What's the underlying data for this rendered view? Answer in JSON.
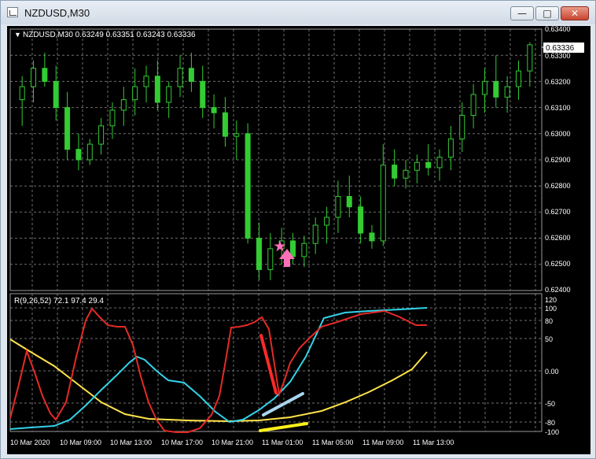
{
  "window": {
    "title": "NZDUSD,M30",
    "controls": {
      "minimize": "—",
      "maximize": "□",
      "close": "✕"
    }
  },
  "colors": {
    "background": "#000000",
    "bull_candle": "#ffffff",
    "bear_candle": "#33cc33",
    "grid": "#6f6f6f",
    "axis_text": "#ffffff",
    "indicator_red": "#e52b26",
    "indicator_cyan": "#33d3e8",
    "indicator_yellow": "#ffe34a",
    "annotation_red": "#ff2a2a",
    "annotation_blue": "#a8d6f0",
    "annotation_yellow": "#ffef1a",
    "marker_pink": "#ff6fb7"
  },
  "main_chart": {
    "header": "NZDUSD,M30  0.63249 0.63351 0.63243 0.63336",
    "current_price_label": "0.63336",
    "price_axis": [
      "0.63400",
      "0.63300",
      "0.63200",
      "0.63100",
      "0.63000",
      "0.62900",
      "0.62800",
      "0.62700",
      "0.62600",
      "0.62500",
      "0.62400"
    ]
  },
  "indicator": {
    "label": "R(9,26,52) 72.1 97.4 29.4",
    "axis_ticks": [
      "120",
      "100",
      "80",
      "50",
      "0.00",
      "-50",
      "-80",
      "-100"
    ]
  },
  "time_axis": [
    "10 Mar 2020",
    "10 Mar 09:00",
    "10 Mar 13:00",
    "10 Mar 17:00",
    "10 Mar 21:00",
    "11 Mar 01:00",
    "11 Mar 05:00",
    "11 Mar 09:00",
    "11 Mar 13:00"
  ],
  "chart_data": {
    "type": "candlestick",
    "symbol": "NZDUSD",
    "timeframe": "M30",
    "ylim": [
      0.624,
      0.634
    ],
    "candles": [
      [
        0.6313,
        0.6322,
        0.6303,
        0.6318
      ],
      [
        0.6318,
        0.6328,
        0.6312,
        0.6325
      ],
      [
        0.6325,
        0.6331,
        0.6318,
        0.632
      ],
      [
        0.632,
        0.6326,
        0.6305,
        0.631
      ],
      [
        0.631,
        0.6316,
        0.629,
        0.6294
      ],
      [
        0.6294,
        0.63,
        0.6286,
        0.629
      ],
      [
        0.629,
        0.6298,
        0.6288,
        0.6296
      ],
      [
        0.6296,
        0.6306,
        0.6292,
        0.6303
      ],
      [
        0.6303,
        0.6312,
        0.6298,
        0.6309
      ],
      [
        0.6309,
        0.6318,
        0.6303,
        0.6313
      ],
      [
        0.6313,
        0.6325,
        0.6307,
        0.6318
      ],
      [
        0.6318,
        0.6326,
        0.6312,
        0.6322
      ],
      [
        0.6322,
        0.6328,
        0.6309,
        0.6312
      ],
      [
        0.6312,
        0.632,
        0.6306,
        0.6318
      ],
      [
        0.6318,
        0.633,
        0.6314,
        0.6325
      ],
      [
        0.6325,
        0.6331,
        0.6316,
        0.632
      ],
      [
        0.632,
        0.6326,
        0.6306,
        0.631
      ],
      [
        0.631,
        0.6315,
        0.6302,
        0.6308
      ],
      [
        0.6308,
        0.6314,
        0.6295,
        0.6299
      ],
      [
        0.6299,
        0.6305,
        0.629,
        0.63
      ],
      [
        0.63,
        0.6304,
        0.6258,
        0.626
      ],
      [
        0.626,
        0.6266,
        0.6244,
        0.6248
      ],
      [
        0.6248,
        0.6262,
        0.6244,
        0.6256
      ],
      [
        0.6256,
        0.6264,
        0.625,
        0.6259
      ],
      [
        0.6259,
        0.6262,
        0.625,
        0.6253
      ],
      [
        0.6253,
        0.6261,
        0.6249,
        0.6258
      ],
      [
        0.6258,
        0.6268,
        0.6254,
        0.6265
      ],
      [
        0.6265,
        0.6272,
        0.6258,
        0.6268
      ],
      [
        0.6268,
        0.6282,
        0.6262,
        0.6276
      ],
      [
        0.6276,
        0.6284,
        0.6268,
        0.6272
      ],
      [
        0.6272,
        0.6276,
        0.6258,
        0.6262
      ],
      [
        0.6262,
        0.6265,
        0.6256,
        0.6259
      ],
      [
        0.6259,
        0.6296,
        0.6257,
        0.6288
      ],
      [
        0.6288,
        0.6294,
        0.628,
        0.6283
      ],
      [
        0.6283,
        0.629,
        0.6279,
        0.6286
      ],
      [
        0.6286,
        0.6292,
        0.6281,
        0.6289
      ],
      [
        0.6289,
        0.6296,
        0.6284,
        0.6287
      ],
      [
        0.6287,
        0.6294,
        0.6282,
        0.6291
      ],
      [
        0.6291,
        0.6303,
        0.6286,
        0.6298
      ],
      [
        0.6298,
        0.6312,
        0.6293,
        0.6307
      ],
      [
        0.6307,
        0.6319,
        0.6302,
        0.6315
      ],
      [
        0.6315,
        0.6325,
        0.6308,
        0.632
      ],
      [
        0.632,
        0.633,
        0.631,
        0.6314
      ],
      [
        0.6314,
        0.6322,
        0.6308,
        0.6318
      ],
      [
        0.6318,
        0.6328,
        0.6313,
        0.6324
      ],
      [
        0.6324,
        0.6335,
        0.6318,
        0.6334
      ]
    ]
  }
}
